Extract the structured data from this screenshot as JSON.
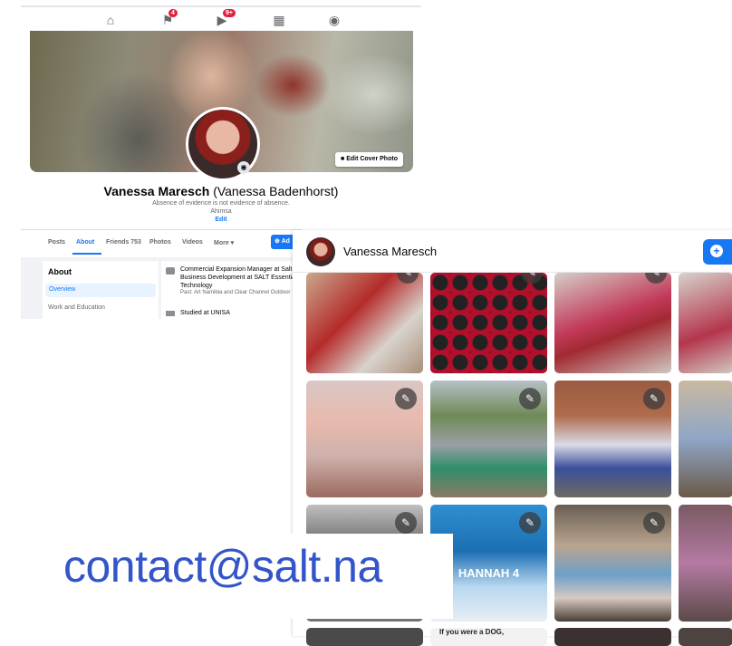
{
  "nav": {
    "icons": [
      "home-icon",
      "flag-icon",
      "watch-icon",
      "marketplace-icon",
      "groups-icon"
    ],
    "flag_badge": "4",
    "watch_badge": "9+"
  },
  "profile": {
    "name": "Vanessa Maresch",
    "alt_name": "(Vanessa Badenhorst)",
    "bio_line1": "Absence of evidence is not evidence of absence.",
    "bio_line2": "Ahimsa",
    "bio_edit": "Edit",
    "edit_cover_label": "Edit Cover Photo"
  },
  "tabs": [
    {
      "label": "Posts"
    },
    {
      "label": "About"
    },
    {
      "label": "Friends 753"
    },
    {
      "label": "Photos"
    },
    {
      "label": "Videos"
    },
    {
      "label": "More ▾"
    }
  ],
  "add_button_label": "Ad",
  "about": {
    "heading": "About",
    "overview": "Overview",
    "work_education": "Work and Education",
    "job_line": "Commercial Expansion Manager at Salt I Business Development at SALT Essential Technology",
    "job_past": "Past: Art Namibia and Clear Channel Outdoor",
    "education": "Studied at UNISA"
  },
  "album": {
    "owner_name": "Vanessa Maresch",
    "row4_caption": "If you were a DOG,",
    "cake_text": "HANNAH 4"
  },
  "overlay": {
    "email": "contact@salt.na"
  },
  "colors": {
    "facebook_blue": "#1877f2",
    "badge_red": "#e41e3f",
    "email_blue": "#3455c9"
  }
}
